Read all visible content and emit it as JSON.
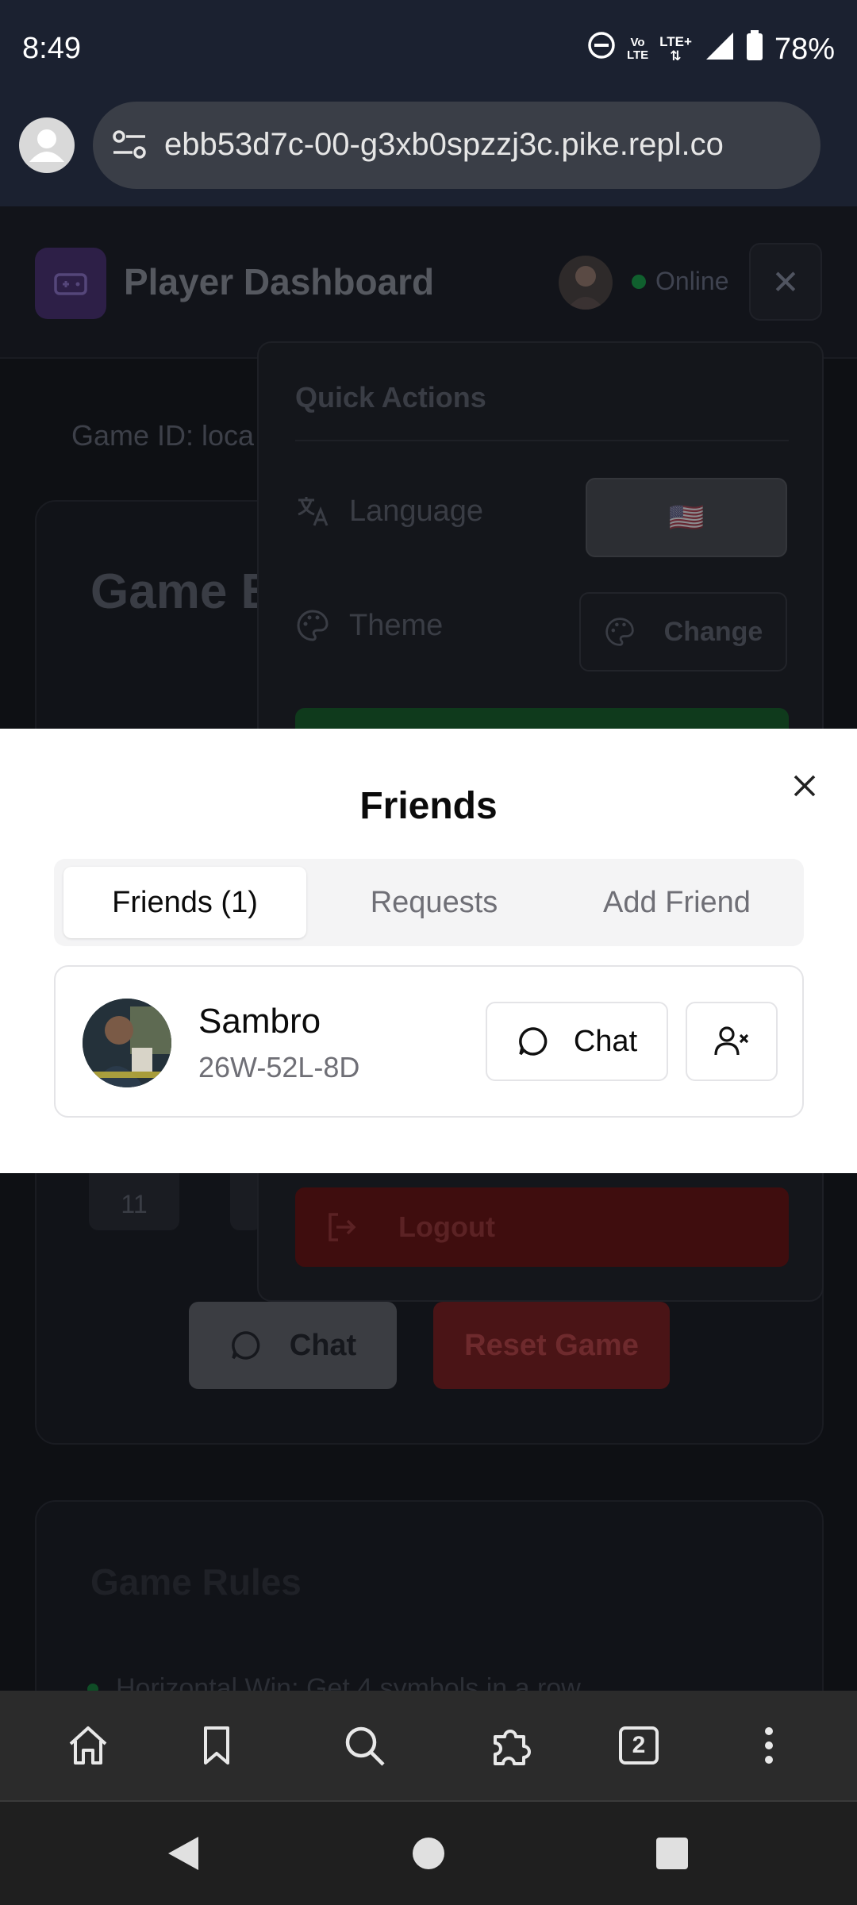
{
  "status_bar": {
    "time": "8:49",
    "network_label_top": "Vo",
    "network_label_bottom": "LTE",
    "lte_label": "LTE+",
    "battery": "78%"
  },
  "browser": {
    "url": "ebb53d7c-00-g3xb0spzzj3c.pike.repl.co",
    "tab_count": "2"
  },
  "app": {
    "title": "Player Dashboard",
    "status": "Online",
    "game_id_text": "Game ID: loca",
    "game_board_title": "Game B",
    "board_cell_value": "11",
    "chat_label": "Chat",
    "reset_label": "Reset Game",
    "rules_title": "Game Rules",
    "rule_1": "Horizontal Win: Get 4 symbols in a row"
  },
  "quick_actions": {
    "title": "Quick Actions",
    "language_label": "Language",
    "language_flag": "🇺🇸",
    "theme_label": "Theme",
    "theme_button": "Change",
    "logout_label": "Logout"
  },
  "friends_modal": {
    "title": "Friends",
    "tabs": [
      {
        "label": "Friends (1)",
        "active": true
      },
      {
        "label": "Requests",
        "active": false
      },
      {
        "label": "Add Friend",
        "active": false
      }
    ],
    "friends": [
      {
        "name": "Sambro",
        "record": "26W-52L-8D",
        "chat_label": "Chat"
      }
    ]
  },
  "colors": {
    "accent_purple": "#2d1f47",
    "online_green": "#10602e",
    "danger_red": "#3f0d0e"
  }
}
